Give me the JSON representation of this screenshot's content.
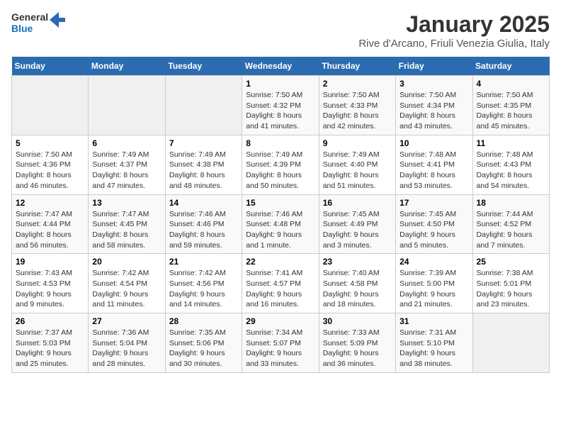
{
  "logo": {
    "line1": "General",
    "line2": "Blue"
  },
  "title": "January 2025",
  "subtitle": "Rive d'Arcano, Friuli Venezia Giulia, Italy",
  "days_of_week": [
    "Sunday",
    "Monday",
    "Tuesday",
    "Wednesday",
    "Thursday",
    "Friday",
    "Saturday"
  ],
  "weeks": [
    [
      {
        "day": "",
        "info": ""
      },
      {
        "day": "",
        "info": ""
      },
      {
        "day": "",
        "info": ""
      },
      {
        "day": "1",
        "info": "Sunrise: 7:50 AM\nSunset: 4:32 PM\nDaylight: 8 hours and 41 minutes."
      },
      {
        "day": "2",
        "info": "Sunrise: 7:50 AM\nSunset: 4:33 PM\nDaylight: 8 hours and 42 minutes."
      },
      {
        "day": "3",
        "info": "Sunrise: 7:50 AM\nSunset: 4:34 PM\nDaylight: 8 hours and 43 minutes."
      },
      {
        "day": "4",
        "info": "Sunrise: 7:50 AM\nSunset: 4:35 PM\nDaylight: 8 hours and 45 minutes."
      }
    ],
    [
      {
        "day": "5",
        "info": "Sunrise: 7:50 AM\nSunset: 4:36 PM\nDaylight: 8 hours and 46 minutes."
      },
      {
        "day": "6",
        "info": "Sunrise: 7:49 AM\nSunset: 4:37 PM\nDaylight: 8 hours and 47 minutes."
      },
      {
        "day": "7",
        "info": "Sunrise: 7:49 AM\nSunset: 4:38 PM\nDaylight: 8 hours and 48 minutes."
      },
      {
        "day": "8",
        "info": "Sunrise: 7:49 AM\nSunset: 4:39 PM\nDaylight: 8 hours and 50 minutes."
      },
      {
        "day": "9",
        "info": "Sunrise: 7:49 AM\nSunset: 4:40 PM\nDaylight: 8 hours and 51 minutes."
      },
      {
        "day": "10",
        "info": "Sunrise: 7:48 AM\nSunset: 4:41 PM\nDaylight: 8 hours and 53 minutes."
      },
      {
        "day": "11",
        "info": "Sunrise: 7:48 AM\nSunset: 4:43 PM\nDaylight: 8 hours and 54 minutes."
      }
    ],
    [
      {
        "day": "12",
        "info": "Sunrise: 7:47 AM\nSunset: 4:44 PM\nDaylight: 8 hours and 56 minutes."
      },
      {
        "day": "13",
        "info": "Sunrise: 7:47 AM\nSunset: 4:45 PM\nDaylight: 8 hours and 58 minutes."
      },
      {
        "day": "14",
        "info": "Sunrise: 7:46 AM\nSunset: 4:46 PM\nDaylight: 8 hours and 59 minutes."
      },
      {
        "day": "15",
        "info": "Sunrise: 7:46 AM\nSunset: 4:48 PM\nDaylight: 9 hours and 1 minute."
      },
      {
        "day": "16",
        "info": "Sunrise: 7:45 AM\nSunset: 4:49 PM\nDaylight: 9 hours and 3 minutes."
      },
      {
        "day": "17",
        "info": "Sunrise: 7:45 AM\nSunset: 4:50 PM\nDaylight: 9 hours and 5 minutes."
      },
      {
        "day": "18",
        "info": "Sunrise: 7:44 AM\nSunset: 4:52 PM\nDaylight: 9 hours and 7 minutes."
      }
    ],
    [
      {
        "day": "19",
        "info": "Sunrise: 7:43 AM\nSunset: 4:53 PM\nDaylight: 9 hours and 9 minutes."
      },
      {
        "day": "20",
        "info": "Sunrise: 7:42 AM\nSunset: 4:54 PM\nDaylight: 9 hours and 11 minutes."
      },
      {
        "day": "21",
        "info": "Sunrise: 7:42 AM\nSunset: 4:56 PM\nDaylight: 9 hours and 14 minutes."
      },
      {
        "day": "22",
        "info": "Sunrise: 7:41 AM\nSunset: 4:57 PM\nDaylight: 9 hours and 16 minutes."
      },
      {
        "day": "23",
        "info": "Sunrise: 7:40 AM\nSunset: 4:58 PM\nDaylight: 9 hours and 18 minutes."
      },
      {
        "day": "24",
        "info": "Sunrise: 7:39 AM\nSunset: 5:00 PM\nDaylight: 9 hours and 21 minutes."
      },
      {
        "day": "25",
        "info": "Sunrise: 7:38 AM\nSunset: 5:01 PM\nDaylight: 9 hours and 23 minutes."
      }
    ],
    [
      {
        "day": "26",
        "info": "Sunrise: 7:37 AM\nSunset: 5:03 PM\nDaylight: 9 hours and 25 minutes."
      },
      {
        "day": "27",
        "info": "Sunrise: 7:36 AM\nSunset: 5:04 PM\nDaylight: 9 hours and 28 minutes."
      },
      {
        "day": "28",
        "info": "Sunrise: 7:35 AM\nSunset: 5:06 PM\nDaylight: 9 hours and 30 minutes."
      },
      {
        "day": "29",
        "info": "Sunrise: 7:34 AM\nSunset: 5:07 PM\nDaylight: 9 hours and 33 minutes."
      },
      {
        "day": "30",
        "info": "Sunrise: 7:33 AM\nSunset: 5:09 PM\nDaylight: 9 hours and 36 minutes."
      },
      {
        "day": "31",
        "info": "Sunrise: 7:31 AM\nSunset: 5:10 PM\nDaylight: 9 hours and 38 minutes."
      },
      {
        "day": "",
        "info": ""
      }
    ]
  ]
}
